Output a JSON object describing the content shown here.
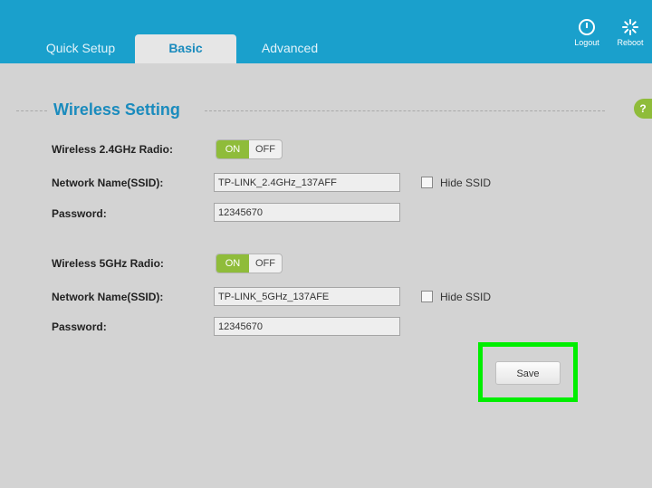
{
  "header": {
    "tabs": [
      {
        "label": "Quick Setup"
      },
      {
        "label": "Basic"
      },
      {
        "label": "Advanced"
      }
    ],
    "logout_label": "Logout",
    "reboot_label": "Reboot"
  },
  "help": {
    "label": "?"
  },
  "section": {
    "title": "Wireless Setting"
  },
  "band24": {
    "radio_label": "Wireless 2.4GHz Radio:",
    "on_label": "ON",
    "off_label": "OFF",
    "ssid_label": "Network Name(SSID):",
    "ssid_value": "TP-LINK_2.4GHz_137AFF",
    "hide_label": "Hide SSID",
    "password_label": "Password:",
    "password_value": "12345670"
  },
  "band5": {
    "radio_label": "Wireless 5GHz Radio:",
    "on_label": "ON",
    "off_label": "OFF",
    "ssid_label": "Network Name(SSID):",
    "ssid_value": "TP-LINK_5GHz_137AFE",
    "hide_label": "Hide SSID",
    "password_label": "Password:",
    "password_value": "12345670"
  },
  "actions": {
    "save_label": "Save"
  },
  "colors": {
    "header": "#1aa0cc",
    "accent": "#1a8bbd",
    "on": "#8fbc3a",
    "highlight": "#00ee00"
  }
}
